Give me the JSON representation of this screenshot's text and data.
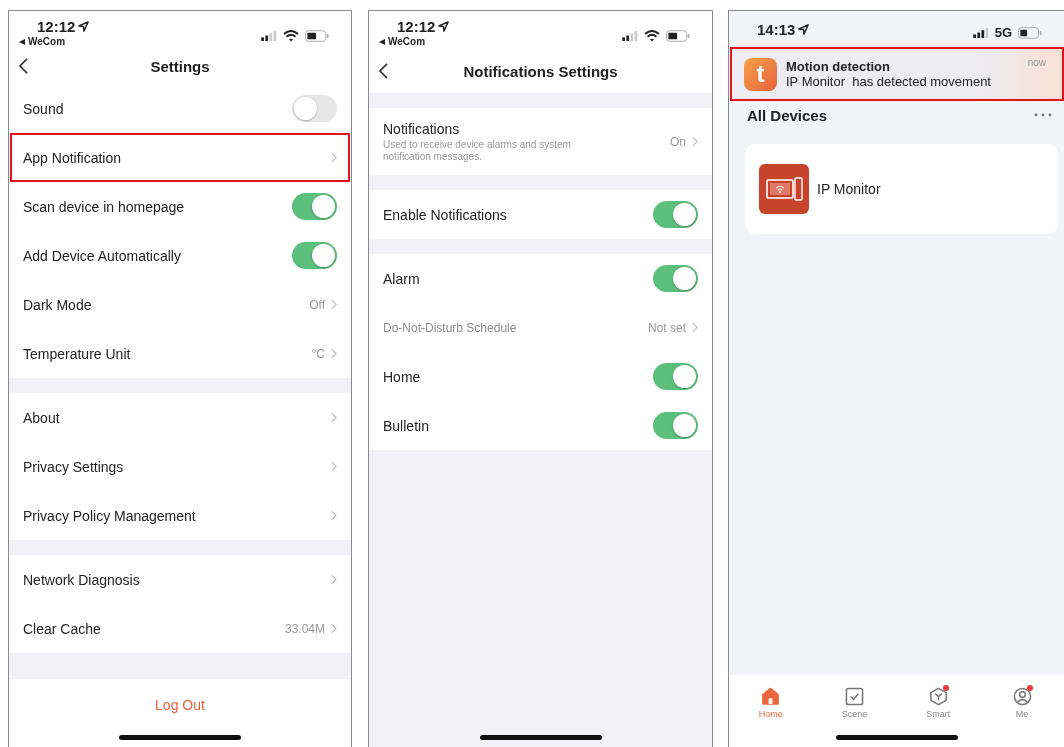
{
  "settings": {
    "status": {
      "time": "12:12",
      "back_label": "WeCom"
    },
    "title": "Settings",
    "groups": [
      {
        "rows": [
          {
            "kind": "toggle",
            "label": "Sound",
            "on": false,
            "highlighted": false
          },
          {
            "kind": "link",
            "label": "App Notification",
            "highlighted": true
          },
          {
            "kind": "toggle",
            "label": "Scan device in homepage",
            "on": true,
            "highlighted": false
          },
          {
            "kind": "toggle",
            "label": "Add Device Automatically",
            "on": true,
            "highlighted": false
          },
          {
            "kind": "link",
            "label": "Dark Mode",
            "value": "Off",
            "highlighted": false
          },
          {
            "kind": "link",
            "label": "Temperature Unit",
            "value": "°C",
            "highlighted": false
          }
        ]
      },
      {
        "rows": [
          {
            "kind": "link",
            "label": "About",
            "highlighted": false
          },
          {
            "kind": "link",
            "label": "Privacy Settings",
            "highlighted": false
          },
          {
            "kind": "link",
            "label": "Privacy Policy Management",
            "highlighted": false
          }
        ]
      },
      {
        "rows": [
          {
            "kind": "link",
            "label": "Network Diagnosis",
            "highlighted": false
          },
          {
            "kind": "link",
            "label": "Clear Cache",
            "value": "33.04M",
            "highlighted": false
          }
        ]
      }
    ],
    "logout": "Log Out"
  },
  "notifications": {
    "status": {
      "time": "12:12",
      "back_label": "WeCom"
    },
    "title": "Notifications Settings",
    "groups": [
      {
        "rows": [
          {
            "kind": "link",
            "label": "Notifications",
            "subtitle": "Used to receive device alarms and system notification messages.",
            "value": "On",
            "disabled": false
          }
        ]
      },
      {
        "rows": [
          {
            "kind": "toggle",
            "label": "Enable Notifications",
            "on": true,
            "disabled": false
          }
        ]
      },
      {
        "rows": [
          {
            "kind": "toggle",
            "label": "Alarm",
            "on": true,
            "disabled": false
          },
          {
            "kind": "link",
            "label": "Do-Not-Disturb Schedule",
            "value": "Not set",
            "disabled": true
          },
          {
            "kind": "toggle",
            "label": "Home",
            "on": true,
            "disabled": false
          },
          {
            "kind": "toggle",
            "label": "Bulletin",
            "on": true,
            "disabled": false
          }
        ]
      }
    ]
  },
  "home": {
    "status": {
      "time": "14:13",
      "cellular_label": "5G"
    },
    "banner": {
      "app_icon_letter": "t",
      "title": "Motion detection",
      "body": "IP Monitor  has detected movement",
      "time": "now",
      "highlighted": true
    },
    "section_title": "All Devices",
    "devices": [
      {
        "name": "IP Monitor"
      }
    ],
    "tabs": [
      {
        "kind": "home",
        "label": "Home",
        "selected": true,
        "badge": false
      },
      {
        "kind": "scene",
        "label": "Scene",
        "selected": false,
        "badge": false
      },
      {
        "kind": "smart",
        "label": "Smart",
        "selected": false,
        "badge": true
      },
      {
        "kind": "me",
        "label": "Me",
        "selected": false,
        "badge": true
      }
    ]
  }
}
